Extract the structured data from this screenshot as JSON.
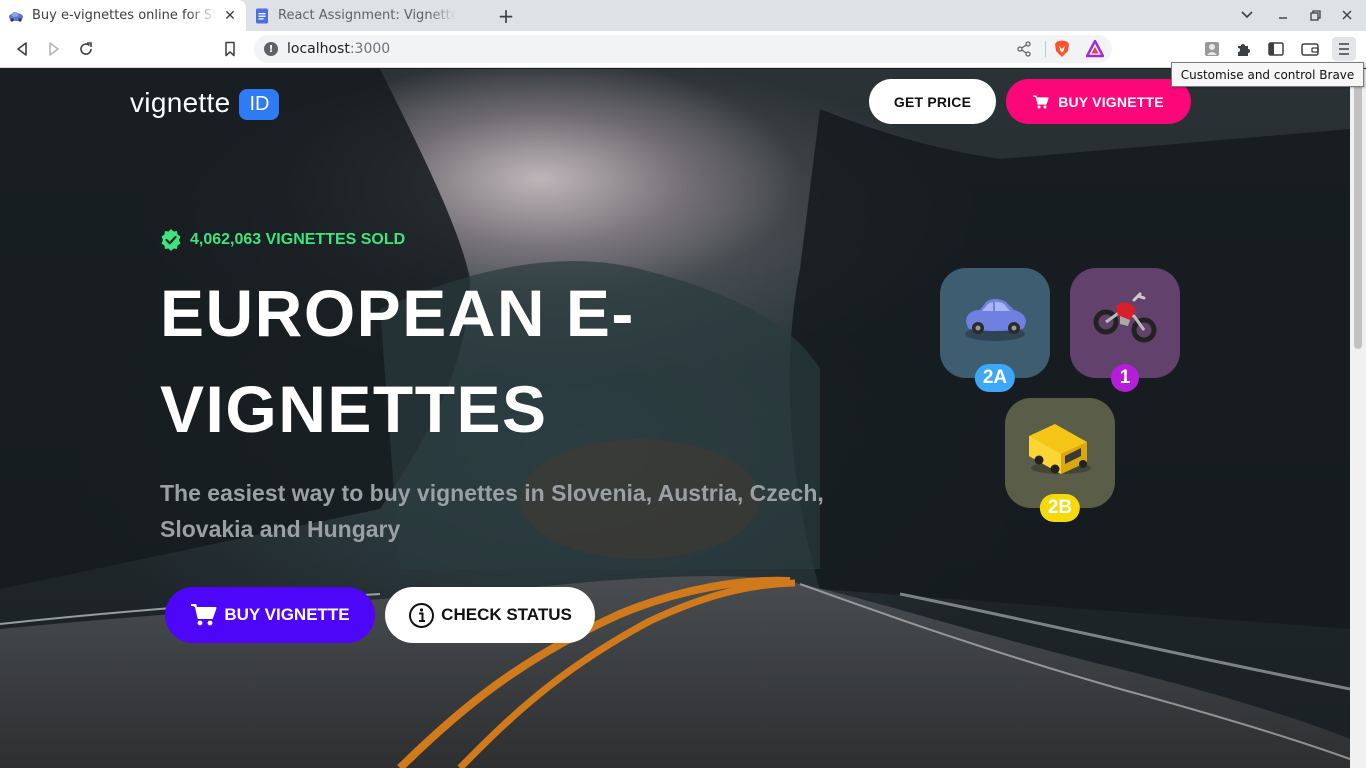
{
  "browser": {
    "tabs": [
      {
        "title": "Buy e-vignettes online for Slovenia",
        "active": true
      },
      {
        "title": "React Assignment: Vignette - Google Docs",
        "active": false
      }
    ],
    "url_host": "localhost",
    "url_port": ":3000",
    "tooltip": "Customise and control Brave"
  },
  "header": {
    "logo_text": "vignette",
    "logo_badge": "ID",
    "get_price_label": "GET PRICE",
    "buy_label": "BUY VIGNETTE"
  },
  "hero": {
    "sold_text": "4,062,063 VIGNETTES SOLD",
    "headline_line1": "EUROPEAN E-",
    "headline_line2": "VIGNETTES",
    "tagline": "The easiest way to buy vignettes in Slovenia, Austria, Czech, Slovakia and Hungary",
    "buy_button": "BUY VIGNETTE",
    "status_button": "CHECK STATUS"
  },
  "vehicles": [
    {
      "name": "car",
      "class_label": "2A",
      "badge_color": "#3da8f5"
    },
    {
      "name": "motorcycle",
      "class_label": "1",
      "badge_color": "#b41ed8"
    },
    {
      "name": "van",
      "class_label": "2B",
      "badge_color": "#f5d90a"
    }
  ],
  "colors": {
    "accent_pink": "#fc0779",
    "accent_purple": "#4d06f7",
    "sold_green": "#3ee47c",
    "logo_blue": "#2f7bf5"
  }
}
